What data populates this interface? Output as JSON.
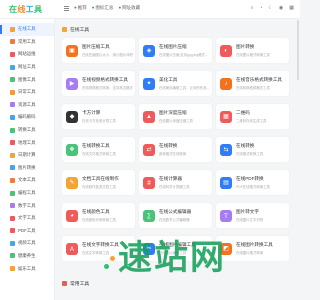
{
  "header": {
    "logo": "在线工具",
    "nav": [
      {
        "label": "推荐"
      },
      {
        "label": "图标汇总"
      },
      {
        "label": "网址收藏"
      }
    ],
    "icons": [
      "search-icon",
      "bell-icon",
      "moon-icon",
      "user-icon",
      "grid-icon"
    ]
  },
  "sidebar": {
    "items": [
      {
        "label": "在线工具",
        "color": "#f4a52f",
        "active": true
      },
      {
        "label": "常用工具",
        "color": "#f27a3a"
      },
      {
        "label": "网站运维",
        "color": "#ef5b5b"
      },
      {
        "label": "网址工具",
        "color": "#39a9f2"
      },
      {
        "label": "图像工具",
        "color": "#49c27a"
      },
      {
        "label": "日常工具",
        "color": "#f29a3a"
      },
      {
        "label": "资源工具",
        "color": "#a77cf2"
      },
      {
        "label": "编码解码",
        "color": "#39a9f2"
      },
      {
        "label": "转换工具",
        "color": "#49c27a"
      },
      {
        "label": "地理工具",
        "color": "#ef5b5b"
      },
      {
        "label": "日期计算",
        "color": "#f4a52f"
      },
      {
        "label": "图片转换",
        "color": "#39a9f2"
      },
      {
        "label": "文本工具",
        "color": "#f27a3a"
      },
      {
        "label": "编程工具",
        "color": "#49c27a"
      },
      {
        "label": "数字工具",
        "color": "#a77cf2"
      },
      {
        "label": "文字工具",
        "color": "#ef5b5b"
      },
      {
        "label": "PDF工具",
        "color": "#ef5b5b"
      },
      {
        "label": "视频工具",
        "color": "#39a9f2"
      },
      {
        "label": "健康养生",
        "color": "#49c27a"
      },
      {
        "label": "娱乐工具",
        "color": "#f4a52f"
      }
    ]
  },
  "main": {
    "section_title": "在线工具",
    "cards": [
      {
        "title": "图片压缩工具",
        "desc": "在线压缩图片大小，减小图片体积",
        "color": "#f3711f",
        "icon": "image-icon"
      },
      {
        "title": "在线图片压缩",
        "desc": "在线图片压缩,支持jpg,png格式的图片压缩",
        "color": "#2f7cf6",
        "icon": "compress-icon"
      },
      {
        "title": "图片转换",
        "desc": "在线图片格式转换工具",
        "color": "#ef5b5b",
        "icon": "convert-icon"
      },
      {
        "title": "在线视频格式转换工具",
        "desc": "在线视频格式转换，支持常见格式",
        "color": "#a77cf2",
        "icon": "video-icon"
      },
      {
        "title": "美化工具",
        "desc": "在线美化编辑工具，让你的作品更好看",
        "color": "#2f7cf6",
        "icon": "beauty-icon"
      },
      {
        "title": "在线音乐格式转换工具",
        "desc": "在线转换音频格式工具",
        "color": "#f3711f",
        "icon": "music-icon"
      },
      {
        "title": "卡方计算",
        "desc": "在线卡方检验计算工具",
        "color": "#333333",
        "icon": "calc-icon"
      },
      {
        "title": "图片深度压缩",
        "desc": "在线图片深度压缩工具",
        "color": "#ef5b5b",
        "icon": "deep-icon"
      },
      {
        "title": "二维码",
        "desc": "二维码在线生成工具",
        "color": "#ef5b5b",
        "icon": "qr-icon"
      },
      {
        "title": "在线转换工具",
        "desc": "在线文件格式转换工具",
        "color": "#49c27a",
        "icon": "file-icon"
      },
      {
        "title": "在线转换",
        "desc": "各种格式在线转换",
        "color": "#ef5b5b",
        "icon": "swap-icon"
      },
      {
        "title": "在线转换",
        "desc": "在线格式转换工具",
        "color": "#2f7cf6",
        "icon": "swap2-icon"
      },
      {
        "title": "文档工具在线制作",
        "desc": "在线制作各类文档工具",
        "color": "#f4a52f",
        "icon": "doc-icon"
      },
      {
        "title": "在线计算器",
        "desc": "在线科学计算器工具",
        "color": "#ef5b5b",
        "icon": "calculator-icon"
      },
      {
        "title": "在线PDF转换",
        "desc": "PDF在线格式转换工具",
        "color": "#2f7cf6",
        "icon": "pdf-icon"
      },
      {
        "title": "在线颜色工具",
        "desc": "在线颜色代码转换工具",
        "color": "#ef5b5b",
        "icon": "color-icon"
      },
      {
        "title": "在线公式编辑器",
        "desc": "在线数学公式编辑器",
        "color": "#49c27a",
        "icon": "formula-icon"
      },
      {
        "title": "图片转文字",
        "desc": "在线图片文字识别",
        "color": "#a77cf2",
        "icon": "ocr-icon"
      },
      {
        "title": "在线文字转换工具",
        "desc": "在线文字转换工具",
        "color": "#ef5b5b",
        "icon": "text-icon"
      },
      {
        "title": "在线图片编辑工具",
        "desc": "在线图片编辑工具",
        "color": "#2f7cf6",
        "icon": "edit-icon"
      },
      {
        "title": "在线图片转换工具",
        "desc": "在线图片格式转换",
        "color": "#f3711f",
        "icon": "img2-icon"
      }
    ],
    "bottom_title": "常用工具"
  },
  "watermark": "速站网"
}
